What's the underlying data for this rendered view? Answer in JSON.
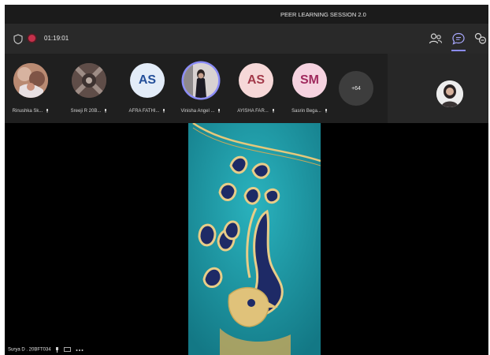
{
  "title_bar": {
    "title": "PEER LEARNING SESSION 2.0"
  },
  "toolbar": {
    "timer": "01:19:01",
    "icons": [
      "shield-icon",
      "record-icon",
      "people-icon",
      "chat-icon",
      "share-icon"
    ]
  },
  "participants": [
    {
      "name": "Rinushka Sk...",
      "type": "photo"
    },
    {
      "name": "Sreeji R 20B...",
      "type": "photo"
    },
    {
      "name": "AFRA FATHI...",
      "initials": "AS",
      "type": "initials"
    },
    {
      "name": "Vinisha Angel ...",
      "type": "photo"
    },
    {
      "name": "AYISHA FAR...",
      "initials": "AS",
      "type": "initials"
    },
    {
      "name": "Sasrin Bega...",
      "initials": "SM",
      "type": "initials"
    }
  ],
  "more_count": "+64",
  "stage_caption": "Surya D . 20BFT034",
  "colors": {
    "accent": "#8b8cf7",
    "recording": "#c4314b",
    "fabric_teal": "#1f9aa8"
  }
}
